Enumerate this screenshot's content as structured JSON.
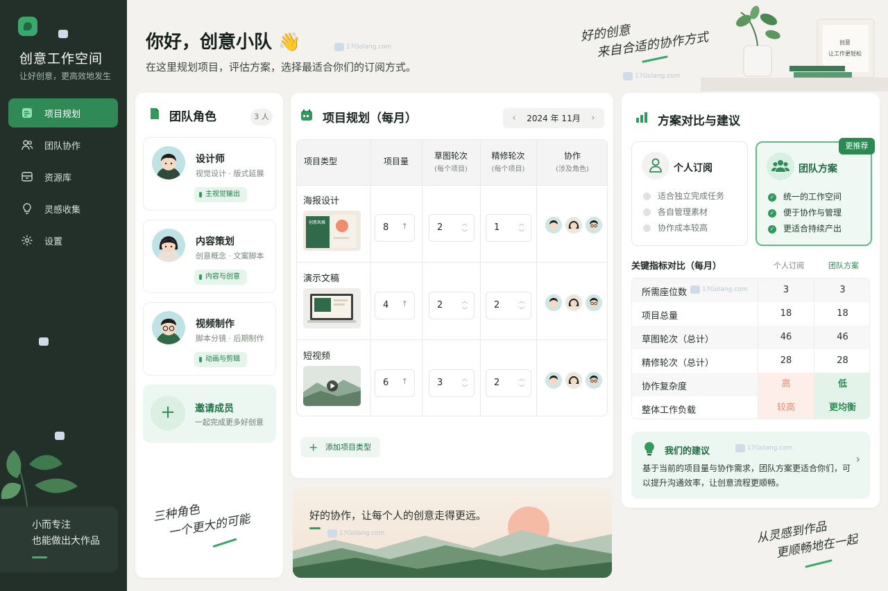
{
  "app": {
    "title": "创意工作空间",
    "subtitle": "让好创意，更高效地发生"
  },
  "nav": [
    {
      "label": "项目规划",
      "icon": "plan-icon",
      "active": true
    },
    {
      "label": "团队协作",
      "icon": "team-icon",
      "active": false
    },
    {
      "label": "资源库",
      "icon": "library-icon",
      "active": false
    },
    {
      "label": "灵感收集",
      "icon": "bulb-icon",
      "active": false
    },
    {
      "label": "设置",
      "icon": "gear-icon",
      "active": false
    }
  ],
  "sidebar_quote": {
    "line1": "小而专注",
    "line2": "也能做出大作品"
  },
  "header": {
    "greeting": "你好，创意小队 👋",
    "subtitle": "在这里规划项目，评估方案，选择最适合你们的订阅方式。"
  },
  "handwriting": {
    "top_line1": "好的创意",
    "top_line2": "来自合适的协作方式",
    "left_line1": "三种角色",
    "left_line2": "一个更大的可能",
    "right_line1": "从灵感到作品",
    "right_line2": "更顺畅地在一起"
  },
  "desk_frame": {
    "line1": "创意",
    "line2": "让工作更轻松"
  },
  "watermark": "17Golang.com",
  "team": {
    "title": "团队角色",
    "count": "3 人",
    "roles": [
      {
        "name": "设计师",
        "desc": "视觉设计 · 版式延展",
        "tag": "主视觉输出"
      },
      {
        "name": "内容策划",
        "desc": "创意概念 · 文案脚本",
        "tag": "内容与创意"
      },
      {
        "name": "视频制作",
        "desc": "脚本分镜 · 后期制作",
        "tag": "动画与剪辑"
      }
    ],
    "invite": {
      "title": "邀请成员",
      "subtitle": "一起完成更多好创意"
    }
  },
  "plan": {
    "title": "项目规划（每月）",
    "month": "2024 年 11月",
    "prev": "‹",
    "next": "›",
    "headers": {
      "type": "项目类型",
      "count": "项目量",
      "draft": "草图轮次",
      "draft_sub": "(每个项目)",
      "refine": "精修轮次",
      "refine_sub": "(每个项目)",
      "collab": "协作",
      "collab_sub": "(涉及角色)"
    },
    "rows": [
      {
        "name": "海报设计",
        "count": "8",
        "draft": "2",
        "refine": "1"
      },
      {
        "name": "演示文稿",
        "count": "4",
        "draft": "2",
        "refine": "2"
      },
      {
        "name": "短视频",
        "count": "6",
        "draft": "3",
        "refine": "2"
      }
    ],
    "add_label": "添加项目类型",
    "thumb_poster_text": "创意风格"
  },
  "banner": {
    "text": "好的协作，让每个人的创意走得更远。"
  },
  "compare": {
    "title": "方案对比与建议",
    "personal": {
      "title": "个人订阅",
      "items": [
        "适合独立完成任务",
        "各自管理素材",
        "协作成本较高"
      ]
    },
    "team": {
      "title": "团队方案",
      "badge": "更推荐",
      "items": [
        "统一的工作空间",
        "便于协作与管理",
        "更适合持续产出"
      ]
    },
    "metrics_title": "关键指标对比（每月）",
    "col_personal": "个人订阅",
    "col_team": "团队方案",
    "metrics": [
      {
        "label": "所需座位数",
        "personal": "3",
        "team": "3"
      },
      {
        "label": "项目总量",
        "personal": "18",
        "team": "18"
      },
      {
        "label": "草图轮次（总计）",
        "personal": "46",
        "team": "46"
      },
      {
        "label": "精修轮次（总计）",
        "personal": "28",
        "team": "28"
      },
      {
        "label": "协作复杂度",
        "personal": "高",
        "team": "低"
      },
      {
        "label": "整体工作负载",
        "personal": "较高",
        "team": "更均衡"
      }
    ],
    "suggestion": {
      "title": "我们的建议",
      "text": "基于当前的项目量与协作需求，团队方案更适合你们，可以提升沟通效率，让创意流程更顺畅。"
    }
  },
  "colors": {
    "sidebar_bg": "#223029",
    "accent": "#2f8a55",
    "bad": "#f4917a",
    "good": "#2b8a52"
  }
}
